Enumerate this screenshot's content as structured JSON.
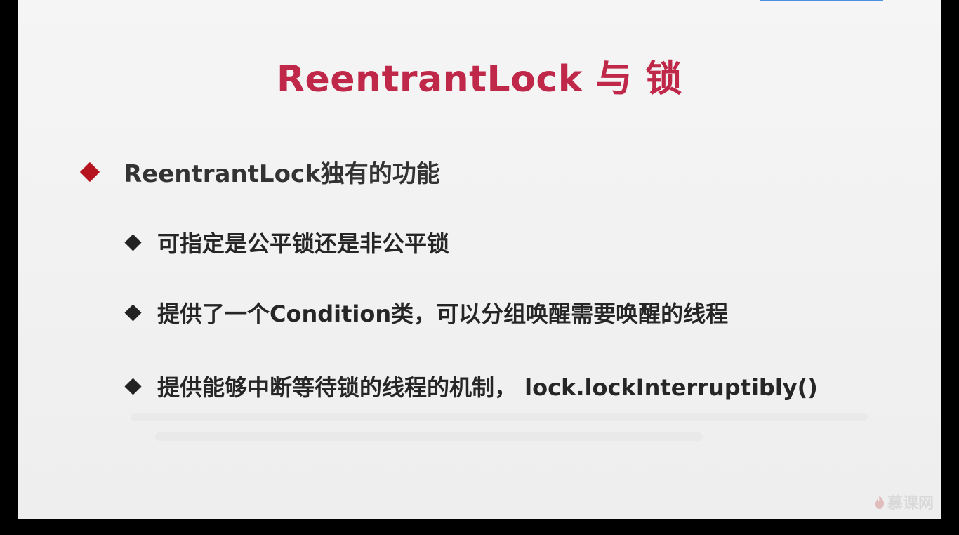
{
  "slide": {
    "title": "ReentrantLock 与 锁",
    "main_bullet": "ReentrantLock独有的功能",
    "sub_bullets": [
      "可指定是公平锁还是非公平锁",
      "提供了一个Condition类，可以分组唤醒需要唤醒的线程",
      "提供能够中断等待锁的线程的机制， lock.lockInterruptibly()"
    ]
  },
  "logo": {
    "text": "慕课网",
    "icon": "flame-icon"
  },
  "colors": {
    "title": "#c0284a",
    "main_bullet_marker": "#b5141e",
    "sub_bullet_marker": "#222222",
    "background": "#f2f2f2"
  }
}
